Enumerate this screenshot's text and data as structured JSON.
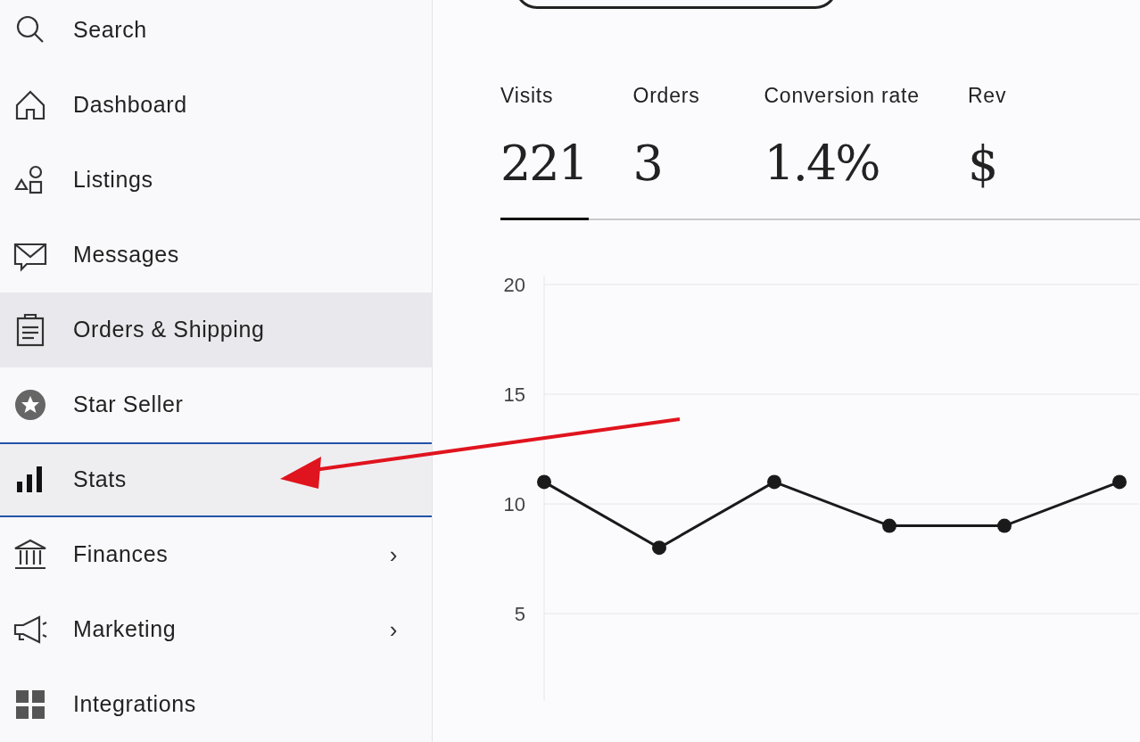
{
  "nav": {
    "items": [
      {
        "label": "Search",
        "selected": false,
        "highlighted": false
      },
      {
        "label": "Dashboard",
        "selected": false,
        "highlighted": false
      },
      {
        "label": "Listings",
        "selected": false,
        "highlighted": false
      },
      {
        "label": "Messages",
        "selected": false,
        "highlighted": false
      },
      {
        "label": "Orders & Shipping",
        "selected": false,
        "highlighted": true
      },
      {
        "label": "Star Seller",
        "selected": false,
        "highlighted": false
      },
      {
        "label": "Stats",
        "selected": true,
        "highlighted": false
      },
      {
        "label": "Finances",
        "selected": false,
        "highlighted": false,
        "chevron": "›"
      },
      {
        "label": "Marketing",
        "selected": false,
        "highlighted": false,
        "chevron": "›"
      },
      {
        "label": "Integrations",
        "selected": false,
        "highlighted": false
      }
    ]
  },
  "metrics": [
    {
      "label": "Visits",
      "value": "221",
      "selected": true
    },
    {
      "label": "Orders",
      "value": "3",
      "selected": false
    },
    {
      "label": "Conversion rate",
      "value": "1.4%",
      "selected": false
    },
    {
      "label": "Rev",
      "value": "$",
      "selected": false
    }
  ],
  "chart_data": {
    "type": "line",
    "ylim": [
      1,
      20
    ],
    "yticks": [
      5,
      10,
      15,
      20
    ],
    "grid": true,
    "series": [
      {
        "color": "#1a1a1a",
        "marker": "o",
        "values": [
          11,
          8,
          11,
          9,
          9,
          11
        ]
      }
    ]
  }
}
